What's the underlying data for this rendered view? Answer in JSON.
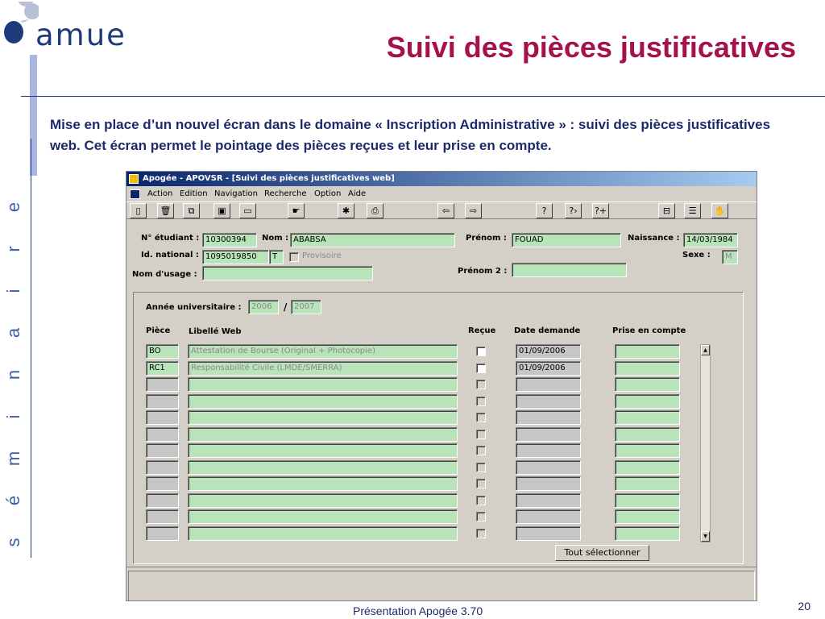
{
  "slide": {
    "logo_text": "amue",
    "title": "Suivi des pièces justificatives",
    "side_word": [
      "s",
      "é",
      "m",
      "i",
      "n",
      "a",
      "i",
      "r",
      "e"
    ],
    "intro": "Mise en place d’un nouvel écran dans le domaine « Inscription Administrative » : suivi des pièces justificatives web. Cet écran permet le pointage des pièces reçues et leur prise en compte.",
    "footer": "Présentation Apogée 3.70",
    "page_number": "20",
    "colors": {
      "title": "#a4114b",
      "text": "#1d2a6a",
      "field": "#b9e3b9",
      "window": "#d4d0c8"
    }
  },
  "window": {
    "title": "Apogée - APOVSR - [Suivi des pièces justificatives web]",
    "menu": [
      "Action",
      "Edition",
      "Navigation",
      "Recherche",
      "Option",
      "Aide"
    ],
    "toolbar": [
      {
        "name": "new-icon",
        "glyph": "▯"
      },
      {
        "name": "delete-icon",
        "glyph": "🗑"
      },
      {
        "name": "copy-icon",
        "glyph": "⧉"
      },
      {
        "name": "save-icon",
        "glyph": "▣"
      },
      {
        "name": "form-icon",
        "glyph": "▭"
      },
      {
        "name": "hand-icon",
        "glyph": "☛"
      },
      {
        "name": "tools-icon",
        "glyph": "✱"
      },
      {
        "name": "print-icon",
        "glyph": "⎙"
      },
      {
        "name": "arrow-left-icon",
        "glyph": "⇦"
      },
      {
        "name": "arrow-right-icon",
        "glyph": "⇨"
      },
      {
        "name": "query-icon",
        "glyph": "?"
      },
      {
        "name": "query-execute-icon",
        "glyph": "?›"
      },
      {
        "name": "query-add-icon",
        "glyph": "?+"
      },
      {
        "name": "window-icon",
        "glyph": "⊟"
      },
      {
        "name": "list-icon",
        "glyph": "☰"
      },
      {
        "name": "hand-stop-icon",
        "glyph": "✋"
      }
    ]
  },
  "student": {
    "num_label": "N° étudiant :",
    "num_value": "10300394",
    "nom_label": "Nom :",
    "nom_value": "ABABSA",
    "prenom_label": "Prénom :",
    "prenom_value": "FOUAD",
    "naissance_label": "Naissance :",
    "naissance_value": "14/03/1984",
    "national_label": "Id. national :",
    "national_value": "1095019850",
    "national_suffix": "T",
    "provisoire_label": "Provisoire",
    "sexe_label": "Sexe :",
    "sexe_value": "M",
    "usage_label": "Nom d'usage :",
    "usage_value": "",
    "prenom2_label": "Prénom 2 :",
    "prenom2_value": ""
  },
  "year": {
    "label": "Année universitaire :",
    "start": "2006",
    "separator": "/",
    "end": "2007"
  },
  "table": {
    "headers": {
      "piece": "Pièce",
      "libelle": "Libellé Web",
      "recue": "Reçue",
      "date": "Date demande",
      "prise": "Prise en compte"
    },
    "rows": [
      {
        "piece": "BO",
        "libelle": "Attestation de Bourse (Original + Photocopie)",
        "date": "01/09/2006",
        "filled": true
      },
      {
        "piece": "RC1",
        "libelle": "Responsabilité Civile (LMDE/SMERRA)",
        "date": "01/09/2006",
        "filled": true
      },
      {
        "piece": "",
        "libelle": "",
        "date": "",
        "filled": false
      },
      {
        "piece": "",
        "libelle": "",
        "date": "",
        "filled": false
      },
      {
        "piece": "",
        "libelle": "",
        "date": "",
        "filled": false
      },
      {
        "piece": "",
        "libelle": "",
        "date": "",
        "filled": false
      },
      {
        "piece": "",
        "libelle": "",
        "date": "",
        "filled": false
      },
      {
        "piece": "",
        "libelle": "",
        "date": "",
        "filled": false
      },
      {
        "piece": "",
        "libelle": "",
        "date": "",
        "filled": false
      },
      {
        "piece": "",
        "libelle": "",
        "date": "",
        "filled": false
      },
      {
        "piece": "",
        "libelle": "",
        "date": "",
        "filled": false
      },
      {
        "piece": "",
        "libelle": "",
        "date": "",
        "filled": false
      }
    ]
  },
  "buttons": {
    "select_all": "Tout sélectionner"
  }
}
